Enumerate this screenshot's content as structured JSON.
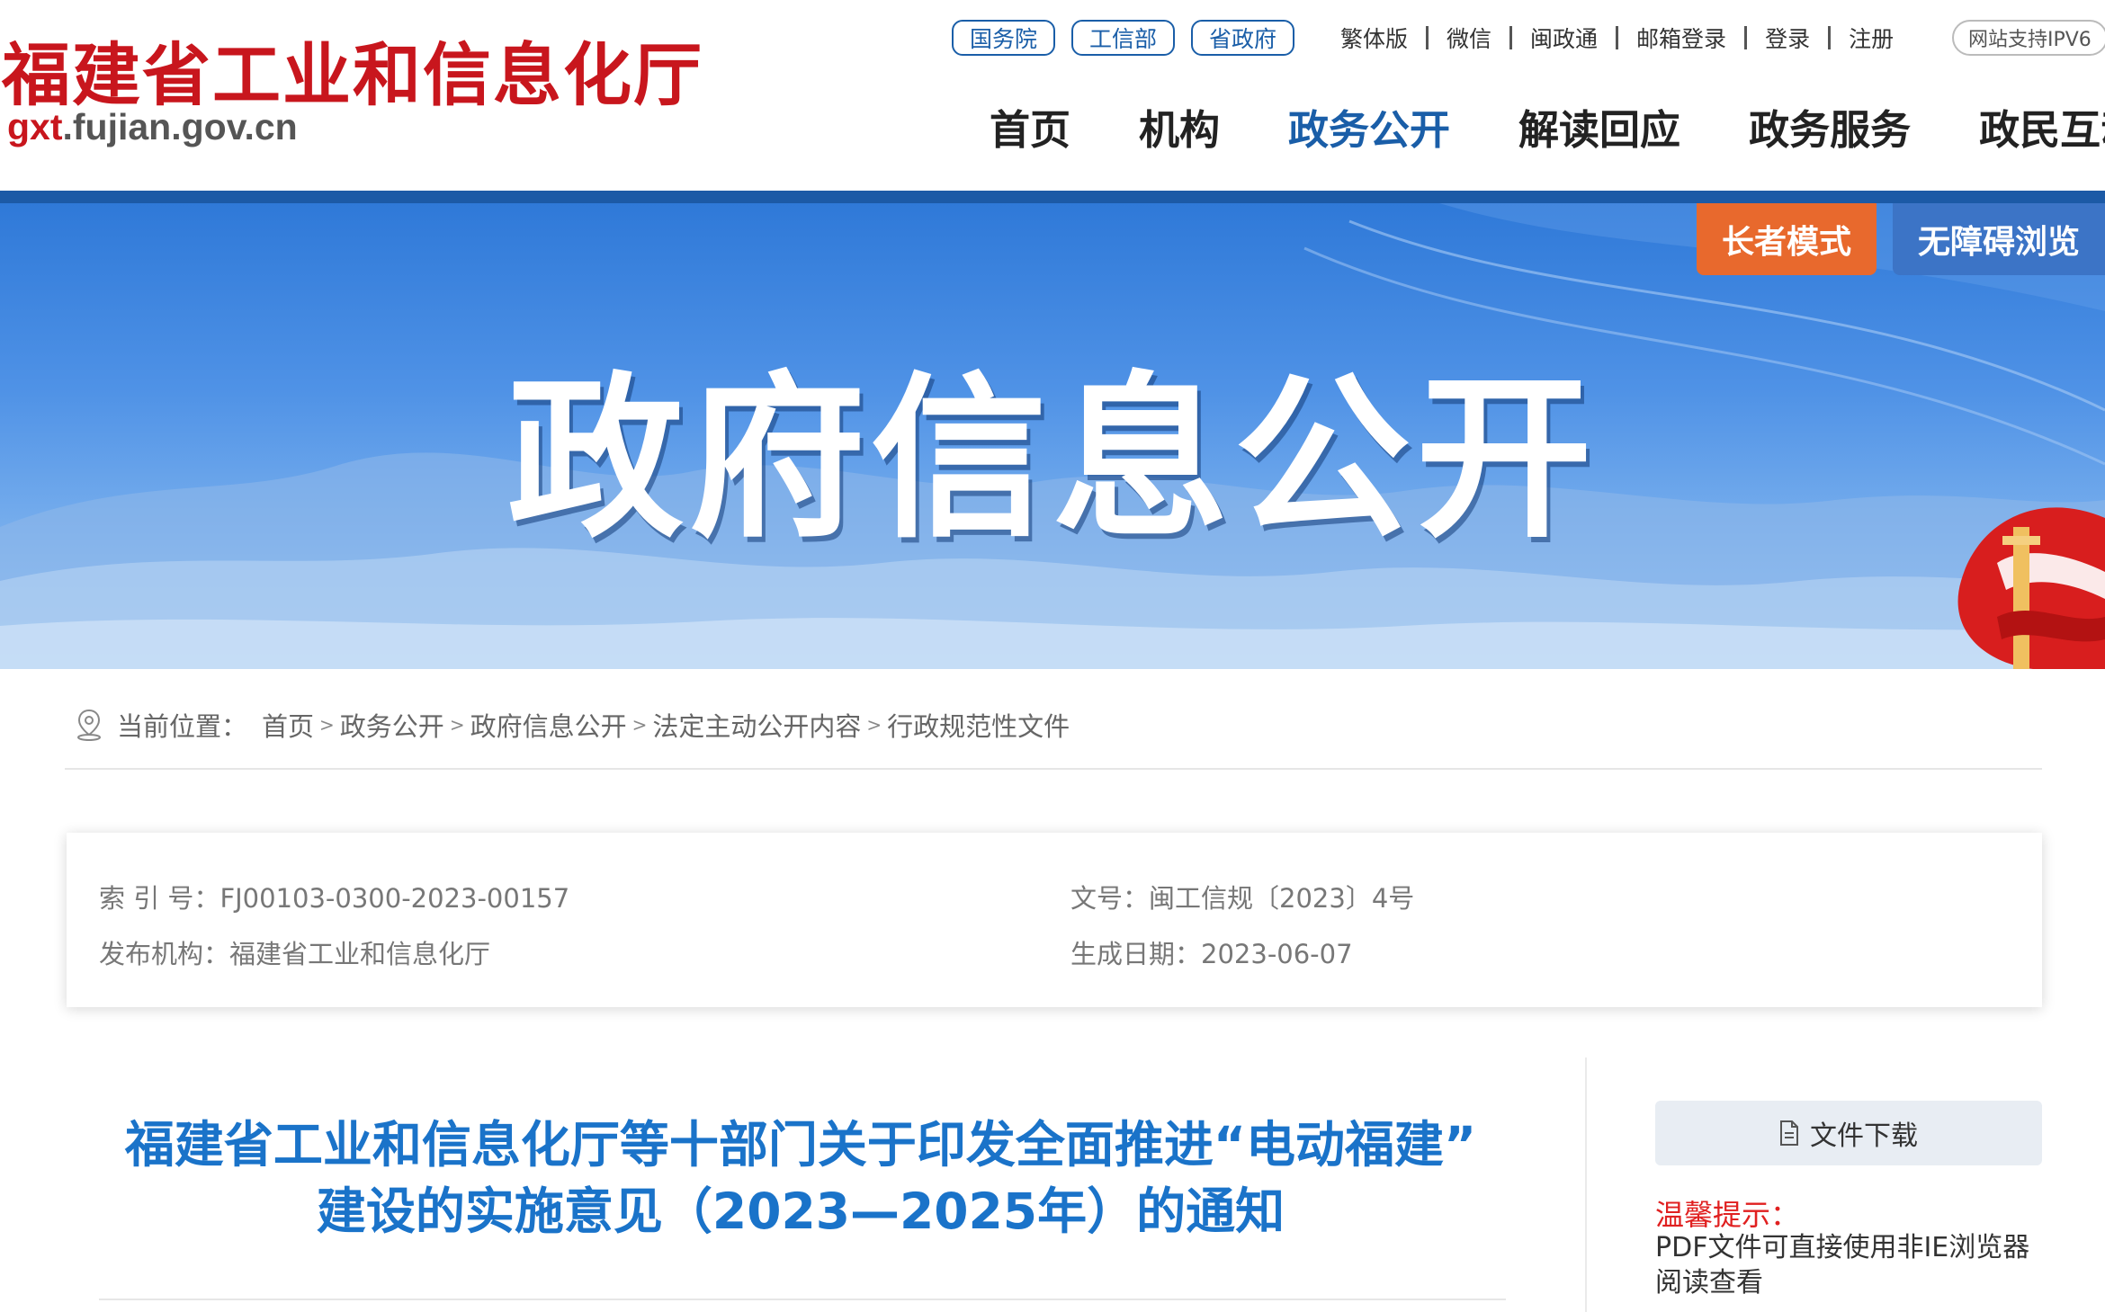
{
  "header": {
    "logo_text": "福建省工业和信息化厅",
    "site_url_prefix": "gxt",
    "site_url_rest": ".fujian.gov.cn",
    "gov_links": [
      "国务院",
      "工信部",
      "省政府"
    ],
    "util_links": [
      "繁体版",
      "微信",
      "闽政通",
      "邮箱登录",
      "登录",
      "注册"
    ],
    "ipv6_label": "网站支持IPV6",
    "nav": [
      {
        "label": "首页",
        "active": false
      },
      {
        "label": "机构",
        "active": false
      },
      {
        "label": "政务公开",
        "active": true
      },
      {
        "label": "解读回应",
        "active": false
      },
      {
        "label": "政务服务",
        "active": false
      },
      {
        "label": "政民互动",
        "active": false
      }
    ]
  },
  "banner": {
    "title": "政府信息公开",
    "elder_mode_label": "长者模式",
    "accessibility_label": "无障碍浏览"
  },
  "breadcrumb": {
    "label": "当前位置：",
    "items": [
      "首页",
      "政务公开",
      "政府信息公开",
      "法定主动公开内容",
      "行政规范性文件"
    ],
    "separator": ">"
  },
  "meta": {
    "index_label": "索 引 号：",
    "index_value": "FJ00103-0300-2023-00157",
    "doc_no_label": "文号：",
    "doc_no_value": "闽工信规〔2023〕4号",
    "publisher_label": "发布机构：",
    "publisher_value": "福建省工业和信息化厅",
    "date_label": "生成日期：",
    "date_value": "2023-06-07"
  },
  "article": {
    "title_line1": "福建省工业和信息化厅等十部门关于印发全面推进“电动福建”",
    "title_line2": "建设的实施意见（2023—2025年）的通知"
  },
  "sidebar": {
    "download_label": "文件下载",
    "tip_title": "温馨提示：",
    "tip_body": "PDF文件可直接使用非IE浏览器阅读查看"
  },
  "colors": {
    "brand_red": "#c8161d",
    "brand_blue": "#1a5ea8",
    "title_blue": "#1a73c9",
    "elder_orange": "#e8692d"
  }
}
